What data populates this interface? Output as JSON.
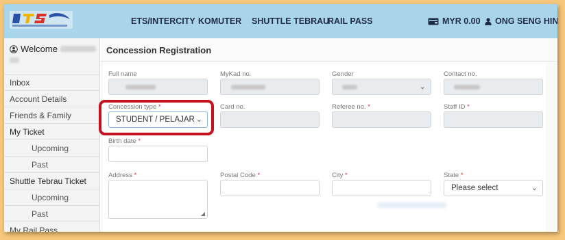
{
  "topnav": {
    "links": [
      "ETS/INTERCITY",
      "KOMUTER",
      "SHUTTLE TEBRAU",
      "RAIL PASS"
    ],
    "balance": "MYR 0.00",
    "user_name": "ONG SENG HIN"
  },
  "sidebar": {
    "welcome": "Welcome",
    "items": [
      {
        "label": "Inbox"
      },
      {
        "label": "Account Details"
      },
      {
        "label": "Friends & Family"
      },
      {
        "label": "My Ticket"
      },
      {
        "label": "Upcoming"
      },
      {
        "label": "Past"
      },
      {
        "label": "Shuttle Tebrau Ticket"
      },
      {
        "label": "Upcoming"
      },
      {
        "label": "Past"
      },
      {
        "label": "My Rail Pass"
      }
    ]
  },
  "main": {
    "title": "Concession Registration",
    "fields": {
      "full_name": {
        "label": "Full name"
      },
      "mykad": {
        "label": "MyKad no."
      },
      "gender": {
        "label": "Gender"
      },
      "contact": {
        "label": "Contact no."
      },
      "concession_type": {
        "label": "Concession type",
        "value": "STUDENT / PELAJAR"
      },
      "card_no": {
        "label": "Card no."
      },
      "referee_no": {
        "label": "Referee no."
      },
      "staff_id": {
        "label": "Staff ID"
      },
      "birth_date": {
        "label": "Birth date"
      },
      "address": {
        "label": "Address"
      },
      "postal_code": {
        "label": "Postal Code"
      },
      "city": {
        "label": "City"
      },
      "state": {
        "label": "State",
        "value": "Please select"
      }
    },
    "required_mark": "*"
  },
  "colors": {
    "nav_bg": "#a9d5ea",
    "highlight": "#c2131f",
    "required": "#d0333b",
    "page_bg": "#f7c77a"
  }
}
